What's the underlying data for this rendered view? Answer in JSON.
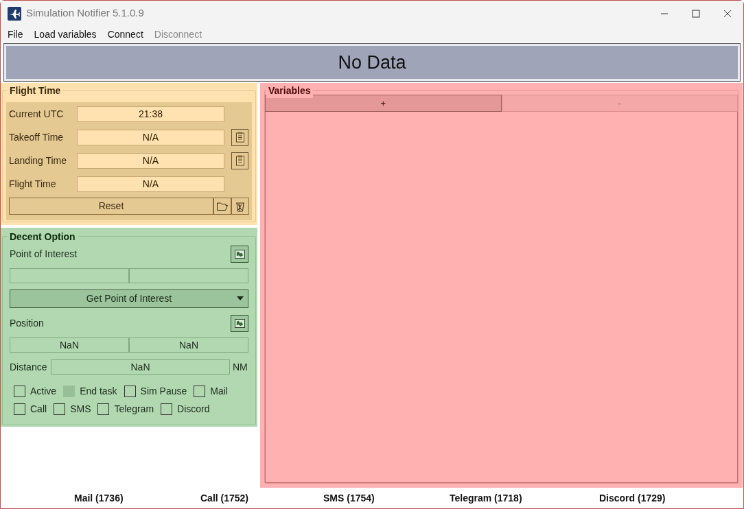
{
  "window": {
    "title": "Simulation Notifier 5.1.0.9"
  },
  "menu": [
    {
      "label": "File",
      "disabled": false
    },
    {
      "label": "Load variables",
      "disabled": false
    },
    {
      "label": "Connect",
      "disabled": false
    },
    {
      "label": "Disconnect",
      "disabled": true
    }
  ],
  "banner": {
    "text": "No Data"
  },
  "flight_time": {
    "title": "Flight Time",
    "rows": [
      {
        "label": "Current UTC",
        "value": "21:38",
        "clipboard": false
      },
      {
        "label": "Takeoff Time",
        "value": "N/A",
        "clipboard": true
      },
      {
        "label": "Landing Time",
        "value": "N/A",
        "clipboard": true
      },
      {
        "label": "Flight Time",
        "value": "N/A",
        "clipboard": false
      }
    ],
    "reset_button": "Reset"
  },
  "decent_option": {
    "title": "Decent Option",
    "poi_label": "Point of Interest",
    "poi_dropdown": "Get Point of Interest",
    "position_label": "Position",
    "position_fields": [
      {
        "value": "NaN"
      },
      {
        "value": "NaN"
      }
    ],
    "distance_label": "Distance",
    "distance_value": "NaN",
    "distance_unit": "NM",
    "checkboxes": [
      [
        {
          "label": "Active",
          "checked": false,
          "disabled": false
        },
        {
          "label": "End task",
          "checked": false,
          "disabled": true
        },
        {
          "label": "Sim Pause",
          "checked": false,
          "disabled": false
        },
        {
          "label": "Mail",
          "checked": false,
          "disabled": false
        }
      ],
      [
        {
          "label": "Call",
          "checked": false,
          "disabled": false
        },
        {
          "label": "SMS",
          "checked": false,
          "disabled": false
        },
        {
          "label": "Telegram",
          "checked": false,
          "disabled": false
        },
        {
          "label": "Discord",
          "checked": false,
          "disabled": false
        }
      ]
    ]
  },
  "variables": {
    "title": "Variables",
    "buttons": [
      {
        "label": "+",
        "disabled": false
      },
      {
        "label": "-",
        "disabled": true
      }
    ]
  },
  "status_bar": [
    "Mail (1736)",
    "Call (1752)",
    "SMS (1754)",
    "Telegram (1718)",
    "Discord (1729)"
  ]
}
